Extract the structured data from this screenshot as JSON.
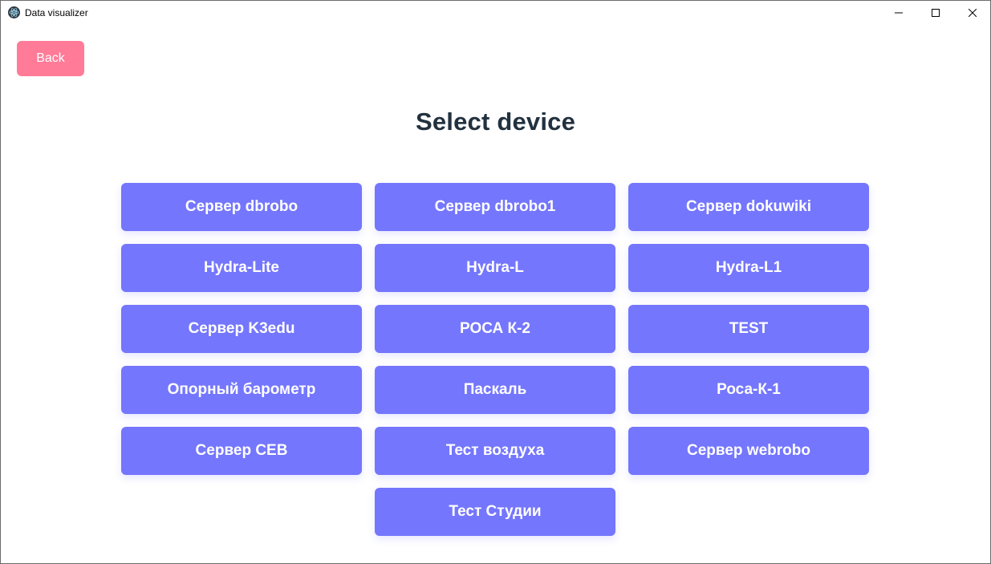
{
  "window": {
    "title": "Data visualizer",
    "icon": "electron-atom-icon"
  },
  "toolbar": {
    "back_label": "Back"
  },
  "page": {
    "title": "Select device"
  },
  "devices": [
    "Сервер dbrobo",
    "Сервер dbrobo1",
    "Сервер dokuwiki",
    "Hydra-Lite",
    "Hydra-L",
    "Hydra-L1",
    "Сервер K3edu",
    "РОСА К-2",
    "TEST",
    "Опорный барометр",
    "Паскаль",
    "Роса-К-1",
    "Сервер СЕВ",
    "Тест воздуха",
    "Сервер webrobo",
    "Тест Студии"
  ],
  "colors": {
    "back_button": "#ff7b98",
    "device_button": "#7476fd",
    "title_text": "#22313f"
  }
}
